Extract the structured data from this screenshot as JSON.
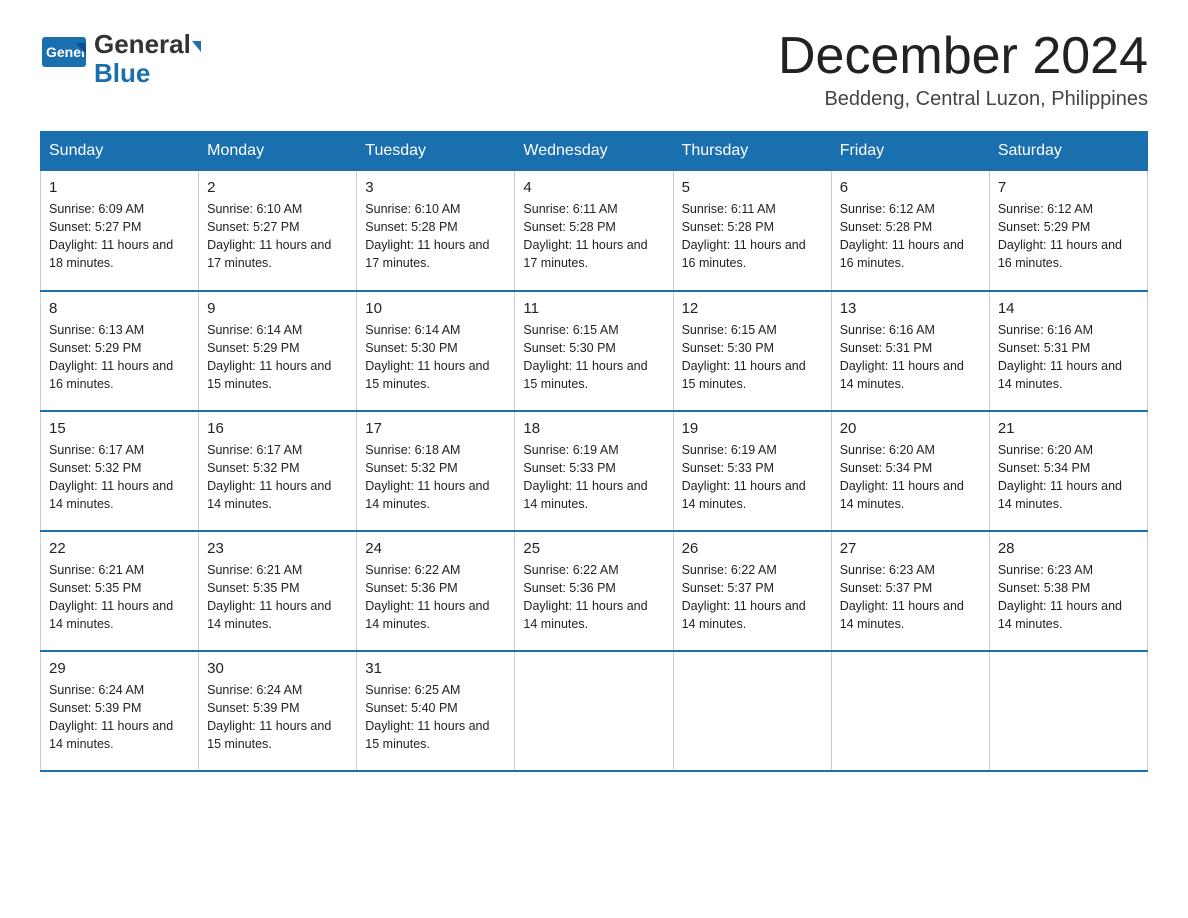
{
  "logo": {
    "general": "General",
    "blue": "Blue",
    "tagline": "GeneralBlue"
  },
  "header": {
    "month_year": "December 2024",
    "location": "Beddeng, Central Luzon, Philippines"
  },
  "days_of_week": [
    "Sunday",
    "Monday",
    "Tuesday",
    "Wednesday",
    "Thursday",
    "Friday",
    "Saturday"
  ],
  "weeks": [
    [
      {
        "day": "1",
        "sunrise": "6:09 AM",
        "sunset": "5:27 PM",
        "daylight": "11 hours and 18 minutes."
      },
      {
        "day": "2",
        "sunrise": "6:10 AM",
        "sunset": "5:27 PM",
        "daylight": "11 hours and 17 minutes."
      },
      {
        "day": "3",
        "sunrise": "6:10 AM",
        "sunset": "5:28 PM",
        "daylight": "11 hours and 17 minutes."
      },
      {
        "day": "4",
        "sunrise": "6:11 AM",
        "sunset": "5:28 PM",
        "daylight": "11 hours and 17 minutes."
      },
      {
        "day": "5",
        "sunrise": "6:11 AM",
        "sunset": "5:28 PM",
        "daylight": "11 hours and 16 minutes."
      },
      {
        "day": "6",
        "sunrise": "6:12 AM",
        "sunset": "5:28 PM",
        "daylight": "11 hours and 16 minutes."
      },
      {
        "day": "7",
        "sunrise": "6:12 AM",
        "sunset": "5:29 PM",
        "daylight": "11 hours and 16 minutes."
      }
    ],
    [
      {
        "day": "8",
        "sunrise": "6:13 AM",
        "sunset": "5:29 PM",
        "daylight": "11 hours and 16 minutes."
      },
      {
        "day": "9",
        "sunrise": "6:14 AM",
        "sunset": "5:29 PM",
        "daylight": "11 hours and 15 minutes."
      },
      {
        "day": "10",
        "sunrise": "6:14 AM",
        "sunset": "5:30 PM",
        "daylight": "11 hours and 15 minutes."
      },
      {
        "day": "11",
        "sunrise": "6:15 AM",
        "sunset": "5:30 PM",
        "daylight": "11 hours and 15 minutes."
      },
      {
        "day": "12",
        "sunrise": "6:15 AM",
        "sunset": "5:30 PM",
        "daylight": "11 hours and 15 minutes."
      },
      {
        "day": "13",
        "sunrise": "6:16 AM",
        "sunset": "5:31 PM",
        "daylight": "11 hours and 14 minutes."
      },
      {
        "day": "14",
        "sunrise": "6:16 AM",
        "sunset": "5:31 PM",
        "daylight": "11 hours and 14 minutes."
      }
    ],
    [
      {
        "day": "15",
        "sunrise": "6:17 AM",
        "sunset": "5:32 PM",
        "daylight": "11 hours and 14 minutes."
      },
      {
        "day": "16",
        "sunrise": "6:17 AM",
        "sunset": "5:32 PM",
        "daylight": "11 hours and 14 minutes."
      },
      {
        "day": "17",
        "sunrise": "6:18 AM",
        "sunset": "5:32 PM",
        "daylight": "11 hours and 14 minutes."
      },
      {
        "day": "18",
        "sunrise": "6:19 AM",
        "sunset": "5:33 PM",
        "daylight": "11 hours and 14 minutes."
      },
      {
        "day": "19",
        "sunrise": "6:19 AM",
        "sunset": "5:33 PM",
        "daylight": "11 hours and 14 minutes."
      },
      {
        "day": "20",
        "sunrise": "6:20 AM",
        "sunset": "5:34 PM",
        "daylight": "11 hours and 14 minutes."
      },
      {
        "day": "21",
        "sunrise": "6:20 AM",
        "sunset": "5:34 PM",
        "daylight": "11 hours and 14 minutes."
      }
    ],
    [
      {
        "day": "22",
        "sunrise": "6:21 AM",
        "sunset": "5:35 PM",
        "daylight": "11 hours and 14 minutes."
      },
      {
        "day": "23",
        "sunrise": "6:21 AM",
        "sunset": "5:35 PM",
        "daylight": "11 hours and 14 minutes."
      },
      {
        "day": "24",
        "sunrise": "6:22 AM",
        "sunset": "5:36 PM",
        "daylight": "11 hours and 14 minutes."
      },
      {
        "day": "25",
        "sunrise": "6:22 AM",
        "sunset": "5:36 PM",
        "daylight": "11 hours and 14 minutes."
      },
      {
        "day": "26",
        "sunrise": "6:22 AM",
        "sunset": "5:37 PM",
        "daylight": "11 hours and 14 minutes."
      },
      {
        "day": "27",
        "sunrise": "6:23 AM",
        "sunset": "5:37 PM",
        "daylight": "11 hours and 14 minutes."
      },
      {
        "day": "28",
        "sunrise": "6:23 AM",
        "sunset": "5:38 PM",
        "daylight": "11 hours and 14 minutes."
      }
    ],
    [
      {
        "day": "29",
        "sunrise": "6:24 AM",
        "sunset": "5:39 PM",
        "daylight": "11 hours and 14 minutes."
      },
      {
        "day": "30",
        "sunrise": "6:24 AM",
        "sunset": "5:39 PM",
        "daylight": "11 hours and 15 minutes."
      },
      {
        "day": "31",
        "sunrise": "6:25 AM",
        "sunset": "5:40 PM",
        "daylight": "11 hours and 15 minutes."
      },
      null,
      null,
      null,
      null
    ]
  ]
}
